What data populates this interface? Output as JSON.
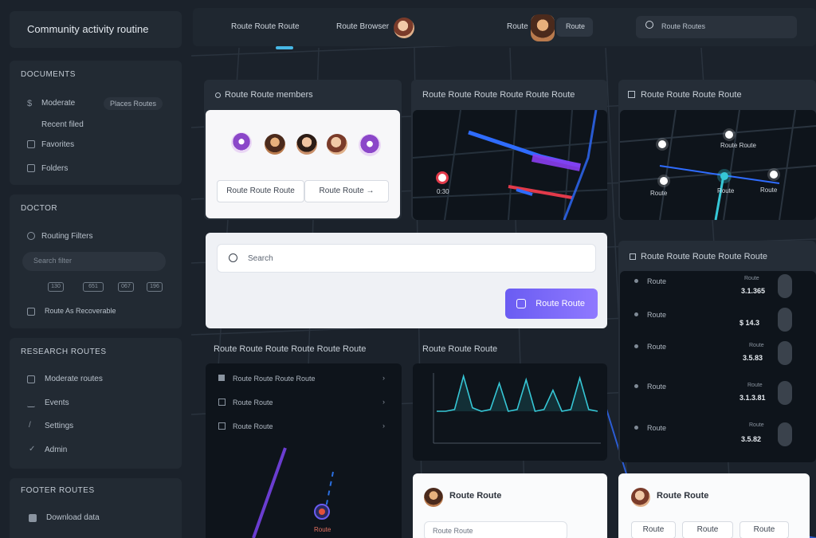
{
  "app": {
    "title": "Community activity routine"
  },
  "sidebar": {
    "section1": {
      "title": "DOCUMENTS",
      "items": [
        {
          "label": "Moderate",
          "chip": "Places Routes"
        },
        {
          "label": "Recent filed"
        },
        {
          "label": "Favorites"
        },
        {
          "label": "Folders"
        }
      ]
    },
    "section2": {
      "title": "DOCTOR",
      "item": "Routing Filters",
      "input_placeholder": "Search filter",
      "codes": [
        "130",
        "651",
        "067",
        "196"
      ],
      "footer": "Route As Recoverable"
    },
    "section3": {
      "title": "RESEARCH ROUTES",
      "items": [
        "Moderate routes",
        "Events",
        "Settings",
        "Admin"
      ]
    },
    "section4": {
      "title": "FOOTER ROUTES",
      "item": "Download data"
    }
  },
  "topbar": {
    "nav1": "Route Route Route",
    "nav2": "Route Browser",
    "nav3": "Route",
    "button": "Route",
    "search_placeholder": "Route Routes"
  },
  "cards": {
    "members": {
      "title": "Route Route members",
      "btn1": "Route Route Route",
      "btn2": "Route Route →"
    },
    "map_heat": {
      "title": "Route Route Route Route Route Route",
      "pin_label": "0:30"
    },
    "map_nodes": {
      "title": "Route Route Route Route",
      "labels": [
        "Route Route",
        "Route",
        "Route",
        "Route"
      ]
    },
    "search": {
      "placeholder": "Search",
      "button": "Route Route"
    },
    "list_left": {
      "title": "Route Route Route Route Route Route",
      "items": [
        "Route Route Route Route",
        "Route Route",
        "Route Route"
      ],
      "badge": "Route"
    },
    "chart": {
      "title": "Route Route Route"
    },
    "stats": {
      "title": "Route Route Route Route Route",
      "rows": [
        {
          "label": "Route",
          "sub": "Route",
          "value": "3.1.365"
        },
        {
          "label": "Route",
          "sub": "",
          "value": "$ 14.3"
        },
        {
          "label": "Route",
          "sub": "Route",
          "value": "3.5.83"
        },
        {
          "label": "Route",
          "sub": "Route",
          "value": "3.1.3.81"
        },
        {
          "label": "Route",
          "sub": "Route",
          "value": "3.5.82"
        }
      ]
    },
    "profile1": {
      "name": "Route Route",
      "input": "Route Route"
    },
    "profile2": {
      "name": "Route Route",
      "tabs": [
        "Route",
        "Route",
        "Route"
      ]
    }
  },
  "chart_data": {
    "type": "line",
    "series": [
      {
        "values": [
          0,
          0,
          0.1,
          2,
          0.2,
          0,
          0.1,
          1.6,
          0,
          0.1,
          1.8,
          0,
          0.1,
          1.2,
          0,
          0.1,
          1.9,
          0.1,
          0
        ]
      }
    ]
  },
  "colors": {
    "accent": "#7a68f6",
    "cyan": "#36c7d6",
    "red": "#e23a4a",
    "blue": "#2f6cff",
    "purple": "#8a3df0"
  }
}
